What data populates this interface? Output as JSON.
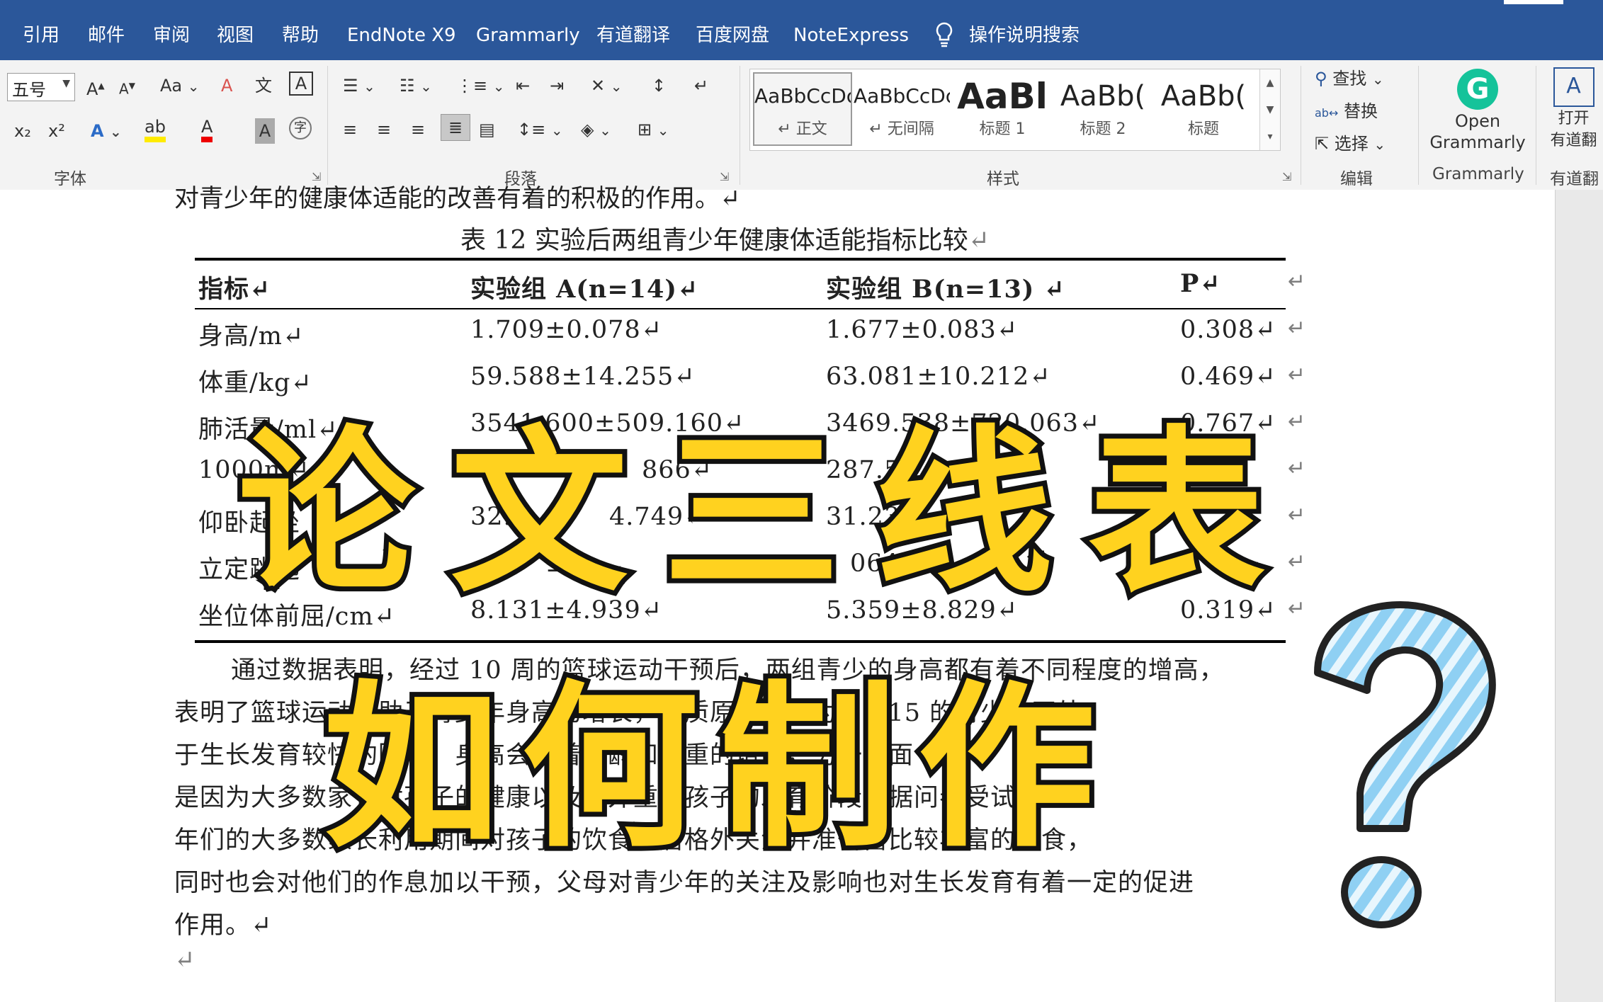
{
  "tabs": [
    "引用",
    "邮件",
    "审阅",
    "视图",
    "帮助",
    "EndNote X9",
    "Grammarly",
    "有道翻译",
    "百度网盘",
    "NoteExpress"
  ],
  "search": {
    "icon": "lightbulb-icon",
    "label": "操作说明搜索"
  },
  "ribbon": {
    "font_group": {
      "label": "字体",
      "font_size": "五号",
      "grow": "A",
      "shrink": "A",
      "case": "Aa",
      "clear": "A",
      "phonetic": "文",
      "border_char": "A",
      "sub": "x₂",
      "sup": "x²",
      "text_effect": "A",
      "highlight": "ab",
      "font_color": "A",
      "shading": "A",
      "enclose": "字"
    },
    "para_group": {
      "label": "段落"
    },
    "styles_group": {
      "label": "样式",
      "styles": [
        {
          "preview": "AaBbCcDc",
          "name": "↵ 正文"
        },
        {
          "preview": "AaBbCcDc",
          "name": "↵ 无间隔"
        },
        {
          "preview": "AaBl",
          "name": "标题 1"
        },
        {
          "preview": "AaBb(",
          "name": "标题 2"
        },
        {
          "preview": "AaBb(",
          "name": "标题"
        }
      ]
    },
    "editing_group": {
      "label": "编辑",
      "find": "查找",
      "replace": "替换",
      "select": "选择"
    },
    "grammarly_group": {
      "label": "Grammarly",
      "open_line1": "Open",
      "open_line2": "Grammarly"
    },
    "youdao_group": {
      "label": "有道翻",
      "line1": "打开",
      "line2": "有道翻"
    }
  },
  "document": {
    "partial_line": "对青少年的健康体适能的改善有着的积极的作用。↵",
    "caption": "表 12 实验后两组青少年健康体适能指标比较",
    "headers": [
      "指标↵",
      "实验组 A(n=14)↵",
      "实验组 B(n=13) ↵",
      "P↵"
    ],
    "rows": [
      [
        "身高/m↵",
        "1.709±0.078↵",
        "1.677±0.083↵",
        "0.308↵"
      ],
      [
        "体重/kg↵",
        "59.588±14.255↵",
        "63.081±10.212↵",
        "0.469↵"
      ],
      [
        "肺活量/ml↵",
        "3541.600±509.160↵",
        "3469.538±720.063↵",
        "0.767↵"
      ],
      [
        "1000m↵",
        "",
        "287.59",
        "↵"
      ],
      [
        "仰卧起坐",
        "32.",
        "31.231",
        "↵"
      ],
      [
        "立定跳远",
        "",
        "064",
        "↵"
      ],
      [
        "坐位体前屈/cm↵",
        "8.131±4.939↵",
        "5.359±8.829↵",
        "0.319↵"
      ]
    ],
    "partial_values": {
      "row4_a": "866↵",
      "row5_a": "4.749↵",
      "row6_a": "±",
      "row6_b": "±"
    },
    "paragraph": [
      "通过数据表明，经过 10 周的篮球运动干预后，两组青少的身高都有着不同程度的增高，",
      "表明了篮球运动有助于青少年身高的增长，体质原因是因为 12-15 的青少年正处",
      "于生长发育较快的阶段，身高会随着年龄和体重的增长，另一方面",
      "是因为大多数家长对孩子的健康以及各外重视孩子的发育阶段，据问卷受试青少",
      "年们的大多数家长利用期间对孩子的饮食起居格外关注并准备富比较丰富的饮食，",
      "同时也会对他们的作息加以干预，父母对青少年的关注及影响也对生长发育有着一定的促进",
      "作用。↵"
    ],
    "empty_para": "↵"
  },
  "overlay": {
    "title_line1": "论文三线表",
    "title_line2": "如何制作"
  },
  "colors": {
    "tabbar": "#2b579a",
    "overlay_fill": "#ffd21f",
    "overlay_stroke": "#111111",
    "question_mark": "#7ec8f0"
  }
}
